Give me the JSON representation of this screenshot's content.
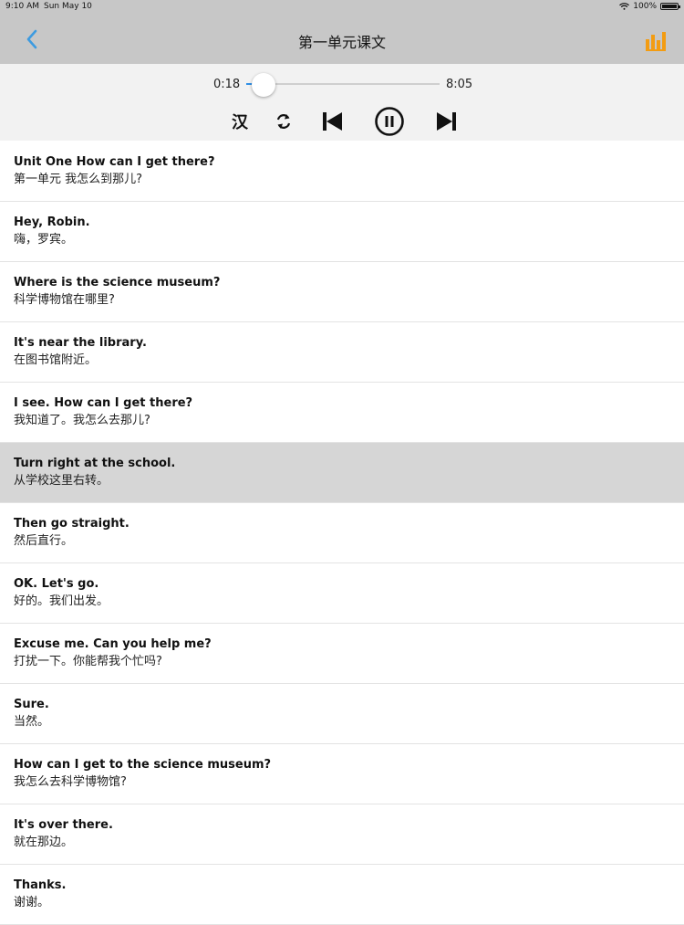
{
  "status_bar": {
    "time": "9:10 AM",
    "date": "Sun May 10",
    "battery": "100%"
  },
  "nav": {
    "title": "第一单元课文",
    "back_icon": "chevron-left-icon",
    "stats_icon": "bar-chart-icon",
    "accent_color": "#f39c12",
    "back_color": "#3d9be0"
  },
  "player": {
    "current_time": "0:18",
    "total_time": "8:05",
    "progress": 0.037,
    "chinese_toggle_label": "汉",
    "icons": [
      "repeat-icon",
      "previous-icon",
      "pause-icon",
      "next-icon"
    ]
  },
  "sentences": [
    {
      "en": "Unit One How can I get there?",
      "zh": "第一单元 我怎么到那儿?"
    },
    {
      "en": "Hey, Robin.",
      "zh": "嗨，罗宾。"
    },
    {
      "en": "Where is the science museum?",
      "zh": "科学博物馆在哪里?"
    },
    {
      "en": "It's near the library.",
      "zh": "在图书馆附近。"
    },
    {
      "en": "I see. How can I get there?",
      "zh": "我知道了。我怎么去那儿?"
    },
    {
      "en": "Turn right at the school.",
      "zh": "从学校这里右转。"
    },
    {
      "en": "Then go straight.",
      "zh": "然后直行。"
    },
    {
      "en": "OK. Let's go.",
      "zh": "好的。我们出发。"
    },
    {
      "en": "Excuse me. Can you help me?",
      "zh": "打扰一下。你能帮我个忙吗?"
    },
    {
      "en": "Sure.",
      "zh": "当然。"
    },
    {
      "en": "How can I get to the science museum?",
      "zh": "我怎么去科学博物馆?"
    },
    {
      "en": "It's over there.",
      "zh": "就在那边。"
    },
    {
      "en": "Thanks.",
      "zh": "谢谢。"
    }
  ],
  "selected_index": 5
}
